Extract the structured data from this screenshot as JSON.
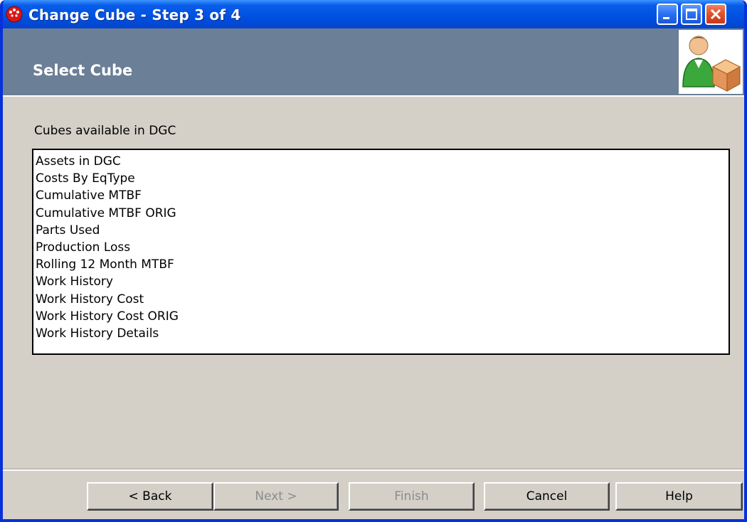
{
  "window": {
    "title": "Change Cube - Step 3 of 4",
    "controls": {
      "minimize": "minimize-icon",
      "maximize": "maximize-icon",
      "close": "close-icon"
    }
  },
  "header": {
    "title": "Select Cube",
    "icon": "user-cube-icon"
  },
  "main": {
    "list_label": "Cubes available in DGC",
    "cubes": [
      "Assets in DGC",
      "Costs By EqType",
      "Cumulative MTBF",
      "Cumulative MTBF ORIG",
      "Parts Used",
      "Production Loss",
      "Rolling 12 Month MTBF",
      "Work History",
      "Work History Cost",
      "Work History Cost ORIG",
      "Work History Details"
    ]
  },
  "footer": {
    "back_label": "< Back",
    "next_label": "Next >",
    "finish_label": "Finish",
    "cancel_label": "Cancel",
    "help_label": "Help"
  },
  "colors": {
    "titlebar": "#0054e3",
    "header_band": "#6b7f96",
    "dialog_face": "#d4d0c8",
    "disabled_text": "#8c8c8c"
  }
}
